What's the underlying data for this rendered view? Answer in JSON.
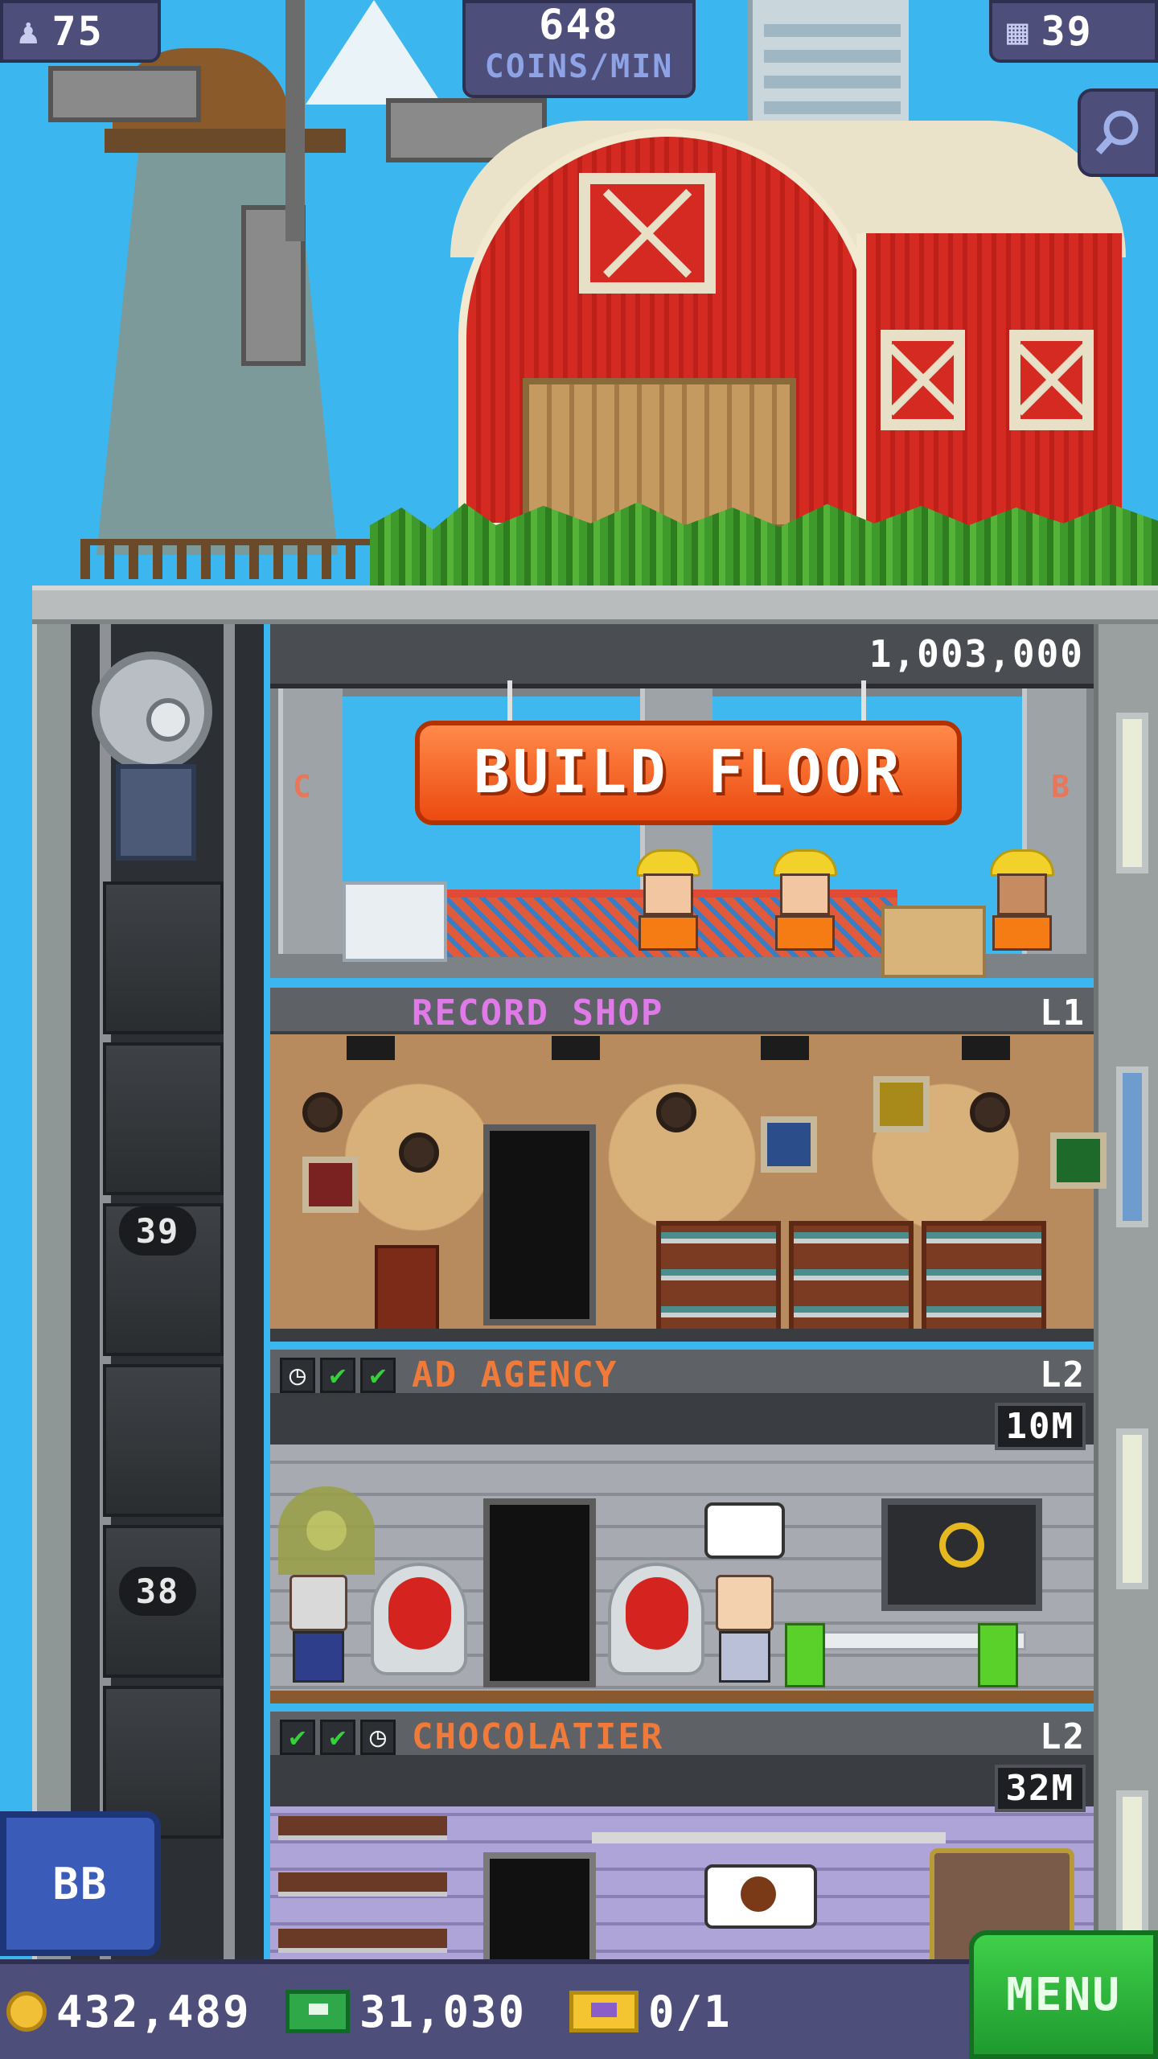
{
  "hud": {
    "population": "75",
    "coins_per_min_value": "648",
    "coins_per_min_label": "COINS/MIN",
    "floor_count": "39"
  },
  "build_floor": {
    "cost": "1,003,000",
    "button_label": "BUILD FLOOR",
    "left_letter": "C",
    "right_letter": "B"
  },
  "elevator": {
    "floor_numbers": [
      "39",
      "38"
    ]
  },
  "floors": [
    {
      "name": "RECORD SHOP",
      "level": "L1",
      "name_color": "#e07ae8"
    },
    {
      "name": "AD AGENCY",
      "level": "L2",
      "price": "10M",
      "name_color": "#f07a3a",
      "status": [
        "clock-icon",
        "check-icon",
        "check-icon"
      ]
    },
    {
      "name": "CHOCOLATIER",
      "level": "L2",
      "price": "32M",
      "name_color": "#f07a3a",
      "status": [
        "check-icon",
        "check-icon",
        "clock-icon"
      ]
    }
  ],
  "bb_button_label": "BB",
  "bottom_bar": {
    "coins": "432,489",
    "bux": "31,030",
    "tickets": "0/1"
  },
  "menu_label": "MENU",
  "colors": {
    "sky": "#3cb6ee",
    "hud": "#4d4e7a",
    "build_button": "#ec4a10",
    "menu_button": "#1f9a2e",
    "check": "#35d03a"
  }
}
